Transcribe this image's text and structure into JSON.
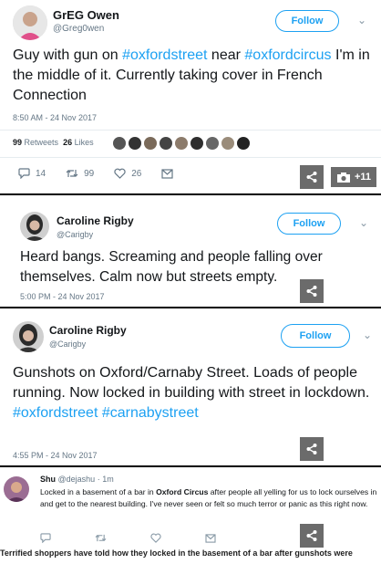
{
  "tweets": [
    {
      "name": "GrEG Owen",
      "handle": "@Greg0wen",
      "follow_label": "Follow",
      "text_parts": [
        "Guy with gun on ",
        "#oxfordstreet",
        " near ",
        "#oxfordcircus",
        " I'm in the middle of it. Currently taking cover in French Connection"
      ],
      "timestamp": "8:50 AM - 24 Nov 2017",
      "retweets_count": "99",
      "retweets_label": "Retweets",
      "likes_count": "26",
      "likes_label": "Likes",
      "reply_count": "14",
      "retweet_action_count": "99",
      "like_action_count": "26",
      "photo_count": "+11"
    },
    {
      "name": "Caroline Rigby",
      "handle": "@Carigby",
      "follow_label": "Follow",
      "text": "Heard bangs. Screaming and people falling over themselves. Calm now but streets empty.",
      "timestamp": "5:00 PM - 24 Nov 2017"
    },
    {
      "name": "Caroline Rigby",
      "handle": "@Carigby",
      "follow_label": "Follow",
      "text_parts": [
        "Gunshots on Oxford/Carnaby Street. Loads of people running. Now locked in building with street in lockdown. ",
        "#oxfordstreet",
        " ",
        "#carnabystreet"
      ],
      "timestamp": "4:55 PM - 24 Nov 2017"
    },
    {
      "name": "Shu",
      "handle": "@dejashu",
      "time": "1m",
      "text_before": "Locked in a basement of a bar in ",
      "text_bold": "Oxford Circus",
      "text_after": " after people all yelling for us to lock ourselves in and get to the nearest building. I've never seen or felt so much terror or panic as this right now."
    }
  ],
  "caption": "Terrified shoppers have told how they locked in the basement of a bar after gunshots were",
  "colors": {
    "accent": "#1da1f2",
    "muted": "#657786",
    "share_bg": "#6b6b6b"
  },
  "icons": [
    "reply-icon",
    "retweet-icon",
    "heart-icon",
    "mail-icon",
    "share-icon",
    "camera-icon",
    "chevron-down-icon"
  ]
}
